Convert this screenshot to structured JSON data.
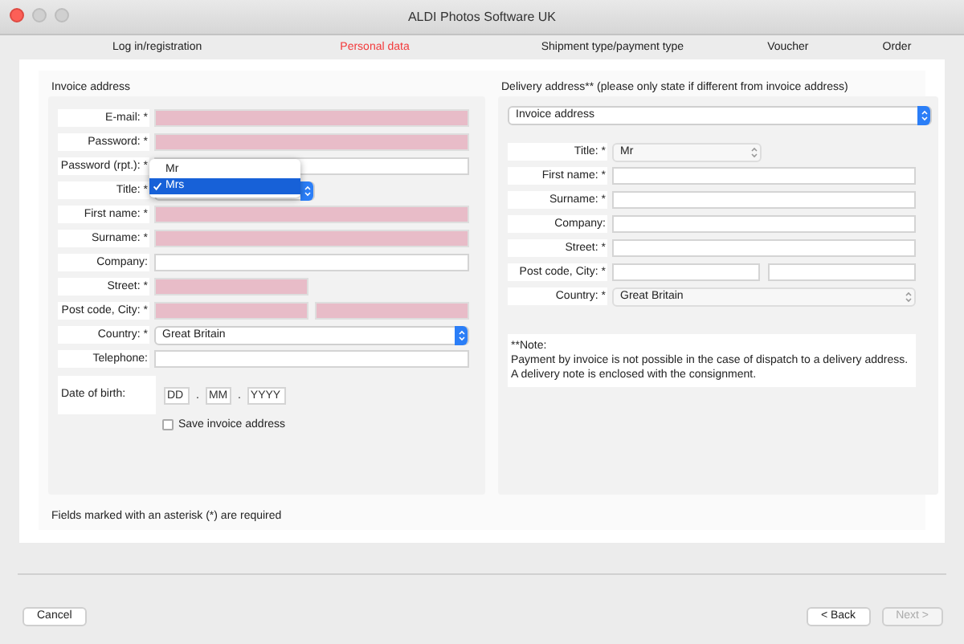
{
  "window": {
    "title": "ALDI Photos Software UK"
  },
  "steps": [
    {
      "label": "Log in/registration",
      "selected": false
    },
    {
      "label": "Personal data",
      "selected": true
    },
    {
      "label": "Shipment type/payment type",
      "selected": false
    },
    {
      "label": "Voucher",
      "selected": false
    },
    {
      "label": "Order",
      "selected": false
    }
  ],
  "invoice": {
    "heading": "Invoice address",
    "fields": [
      {
        "kind": "text",
        "label": "E-mail: *",
        "invalid": true
      },
      {
        "kind": "text",
        "label": "Password: *",
        "invalid": true
      },
      {
        "kind": "text",
        "label": "Password (rpt.): *",
        "invalid": false
      },
      {
        "kind": "popup",
        "label": "Title: *",
        "options": [
          {
            "label": "Mr",
            "selected": false
          },
          {
            "label": "Mrs",
            "selected": true
          }
        ]
      },
      {
        "kind": "text",
        "label": "First name: *",
        "invalid": true
      },
      {
        "kind": "text",
        "label": "Surname: *",
        "invalid": true
      },
      {
        "kind": "text",
        "label": "Company:",
        "invalid": false
      },
      {
        "kind": "half",
        "label": "Street: *",
        "invalid": true
      },
      {
        "kind": "pair",
        "label": "Post code, City: *",
        "invalid": true
      },
      {
        "kind": "select",
        "label": "Country: *",
        "value": "Great Britain"
      },
      {
        "kind": "text",
        "label": "Telephone:",
        "invalid": false
      }
    ],
    "birth": {
      "label": "Date of birth:",
      "placeholders": [
        "DD",
        "MM",
        "YYYY"
      ],
      "separators": [
        ".",
        "."
      ]
    },
    "save": {
      "label": "Save invoice address",
      "checked": false
    }
  },
  "delivery": {
    "heading": "Delivery address** (please only state if different from invoice address)",
    "source": "Invoice address",
    "fields": [
      {
        "kind": "short-select",
        "label": "Title: *",
        "value": "Mr"
      },
      {
        "kind": "text",
        "label": "First name: *",
        "invalid": false
      },
      {
        "kind": "text",
        "label": "Surname: *",
        "invalid": false
      },
      {
        "kind": "text",
        "label": "Company:",
        "invalid": false
      },
      {
        "kind": "text",
        "label": "Street: *",
        "invalid": false
      },
      {
        "kind": "pair",
        "label": "Post code, City: *",
        "invalid": false
      },
      {
        "kind": "grey-select",
        "label": "Country: *",
        "value": "Great Britain"
      }
    ],
    "note": [
      "**Note:",
      "Payment by invoice is not possible in the case of dispatch to a delivery address.",
      "A delivery note is enclosed with the consignment."
    ]
  },
  "footnote": "Fields marked with an asterisk (*) are required",
  "buttons": [
    {
      "label": "Cancel",
      "disabled": false
    },
    {
      "label": "< Back",
      "disabled": false
    },
    {
      "label": "Next >",
      "disabled": true
    }
  ]
}
